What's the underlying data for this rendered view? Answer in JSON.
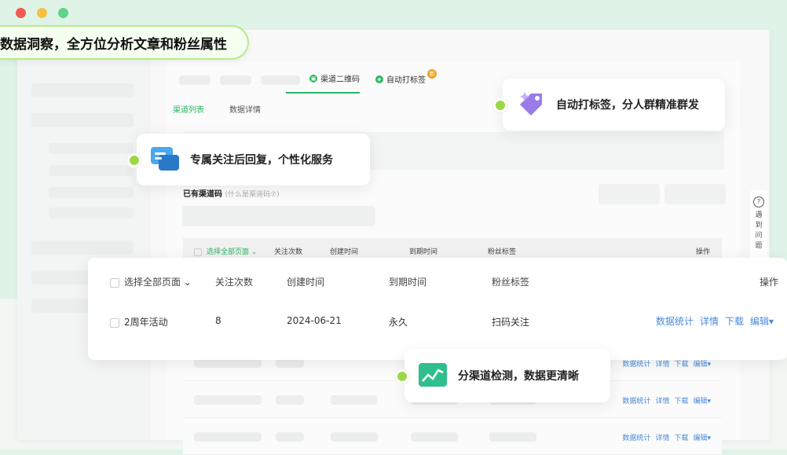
{
  "banner": "数据洞察，全方位分析文章和粉丝属性",
  "tabs": {
    "qr": "渠道二维码",
    "autotag": "自动打标签",
    "badge": "新"
  },
  "subtabs": {
    "list": "渠道列表",
    "detail": "数据详情"
  },
  "section": {
    "title": "已有渠道码",
    "hint": "(什么是渠道码⑦)"
  },
  "bg_table": {
    "headers": [
      "选择全部页面 ⌄",
      "关注次数",
      "创建时间",
      "到期时间",
      "粉丝标签",
      "操作"
    ],
    "actions": [
      "数据统计",
      "详情",
      "下载",
      "编辑▾"
    ]
  },
  "help": {
    "icon": "?",
    "text": "遇到问题"
  },
  "main_table": {
    "headers": [
      "选择全部页面 ⌄",
      "关注次数",
      "创建时间",
      "到期时间",
      "粉丝标签",
      "操作"
    ],
    "row": {
      "name": "2周年活动",
      "count": "8",
      "created": "2024-06-21",
      "expires": "永久",
      "tag": "扫码关注"
    },
    "actions": [
      "数据统计",
      "详情",
      "下载",
      "编辑▾"
    ]
  },
  "callouts": {
    "autotag": "自动打标签，分人群精准群发",
    "reply": "专属关注后回复，个性化服务",
    "detect": "分渠道检测，数据更清晰"
  },
  "colors": {
    "accent": "#2ab565",
    "link": "#4a8ad8",
    "traffic": [
      "#f25b55",
      "#f6c143",
      "#5fd38b"
    ]
  }
}
